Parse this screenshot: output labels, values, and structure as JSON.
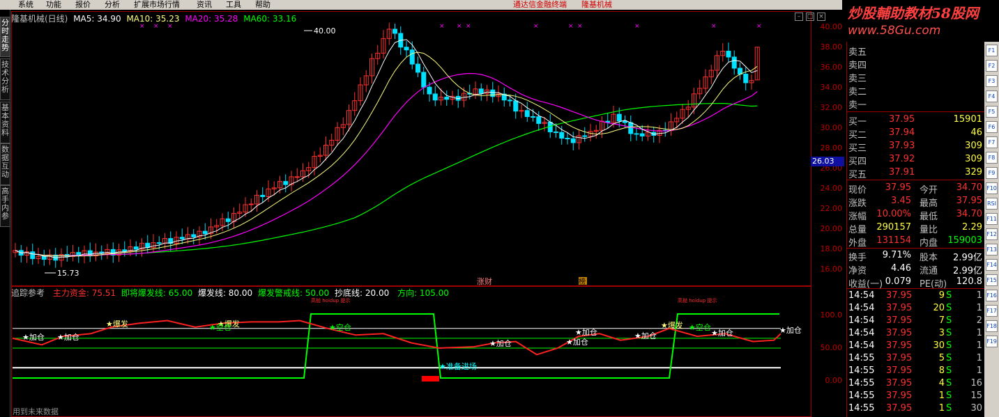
{
  "menu": [
    "系统",
    "功能",
    "报价",
    "分析",
    "扩展市场行情",
    "资讯",
    "工具",
    "帮助"
  ],
  "menu_center": [
    "通达信金融终端",
    "隆基机械"
  ],
  "watermark": {
    "line1": "炒股輔助教材58股网",
    "line2": "www.58Gu.com"
  },
  "left_tabs": [
    "分时走势",
    "技术分析",
    "基本资料",
    "数据互动",
    "高手内参"
  ],
  "main_header": {
    "name": "隆基机械(日线)",
    "ma5": "MA5: 34.90",
    "ma10": "MA10: 35.23",
    "ma20": "MA20: 35.28",
    "ma60": "MA60: 33.16"
  },
  "sub_header": {
    "name": "追踪参考",
    "l1": "主力资金: 75.51",
    "l2": "即将爆发线: 65.00",
    "l3": "爆发线: 80.00",
    "l4": "爆发警戒线: 50.00",
    "l5": "抄底线: 20.00",
    "l6": "方向: 105.00"
  },
  "price_axis": [
    "40.00",
    "38.00",
    "36.00",
    "34.00",
    "32.00",
    "30.00",
    "28.00",
    "26.00",
    "24.00",
    "22.00",
    "20.00",
    "18.00",
    "16.00"
  ],
  "cur_price": "26.03",
  "sub_axis": [
    "100.0",
    "50.00",
    "0.00"
  ],
  "chart_labels": {
    "high": "40.00",
    "low": "15.73",
    "tag1": "涨财",
    "tag2": "榜",
    "note1": "高抛 holdup 提示",
    "note2": "高抛 holdup 提示"
  },
  "signal_labels": [
    "加仓",
    "加仓",
    "爆发",
    "爆发",
    "空仓",
    "空仓",
    "准备进场",
    "加仓",
    "加仓",
    "加仓",
    "加仓",
    "爆发",
    "空仓",
    "加仓",
    "加仓"
  ],
  "quote": {
    "sell": [
      {
        "label": "卖五"
      },
      {
        "label": "卖四"
      },
      {
        "label": "卖三"
      },
      {
        "label": "卖二"
      },
      {
        "label": "卖一"
      }
    ],
    "buy": [
      {
        "label": "买一",
        "price": "37.95",
        "vol": "15901"
      },
      {
        "label": "买二",
        "price": "37.94",
        "vol": "46"
      },
      {
        "label": "买三",
        "price": "37.93",
        "vol": "309"
      },
      {
        "label": "买四",
        "price": "37.92",
        "vol": "309"
      },
      {
        "label": "买五",
        "price": "37.91",
        "vol": "329"
      }
    ],
    "stats": [
      {
        "l1": "现价",
        "v1": "37.95",
        "l2": "今开",
        "v2": "34.70"
      },
      {
        "l1": "涨跌",
        "v1": "3.45",
        "l2": "最高",
        "v2": "37.95"
      },
      {
        "l1": "涨幅",
        "v1": "10.00%",
        "l2": "最低",
        "v2": "34.70"
      },
      {
        "l1": "总量",
        "v1": "290157",
        "l2": "量比",
        "v2": "2.29"
      },
      {
        "l1": "外盘",
        "v1": "131154",
        "l2": "内盘",
        "v2": "159003"
      }
    ],
    "stats2": [
      {
        "l1": "换手",
        "v1": "9.71%",
        "l2": "股本",
        "v2": "2.99亿"
      },
      {
        "l1": "净资",
        "v1": "4.46",
        "l2": "流通",
        "v2": "2.99亿"
      },
      {
        "l1": "收益(一)",
        "v1": "0.079",
        "l2": "PE(动)",
        "v2": "120.8"
      }
    ],
    "ticks": [
      {
        "t": "14:54",
        "p": "37.95",
        "v": "9",
        "s": "S",
        "n": "1"
      },
      {
        "t": "14:54",
        "p": "37.95",
        "v": "20",
        "s": "S",
        "n": "1"
      },
      {
        "t": "14:54",
        "p": "37.95",
        "v": "7",
        "s": "S",
        "n": "2"
      },
      {
        "t": "14:54",
        "p": "37.95",
        "v": "3",
        "s": "S",
        "n": "1"
      },
      {
        "t": "14:54",
        "p": "37.95",
        "v": "30",
        "s": "S",
        "n": "1"
      },
      {
        "t": "14:55",
        "p": "37.95",
        "v": "5",
        "s": "S",
        "n": "1"
      },
      {
        "t": "14:55",
        "p": "37.95",
        "v": "8",
        "s": "S",
        "n": "1"
      },
      {
        "t": "14:55",
        "p": "37.95",
        "v": "4",
        "s": "S",
        "n": "16"
      },
      {
        "t": "14:55",
        "p": "37.95",
        "v": "1",
        "s": "S",
        "n": "15"
      },
      {
        "t": "14:55",
        "p": "37.95",
        "v": "1",
        "s": "S",
        "n": "30"
      }
    ]
  },
  "toolbar_icons": [
    "F1",
    "F2",
    "F3",
    "F4",
    "F5",
    "F6",
    "F7",
    "F8",
    "F9",
    "F10",
    "RSI",
    "F11",
    "F12",
    "F13",
    "F14",
    "F15",
    "F16",
    "F17",
    "F18",
    "F19"
  ],
  "footer": "用到未来数据",
  "colors": {
    "up": "#ff3030",
    "down": "#00e0ff",
    "ma5": "#ffffff",
    "ma10": "#ffff80",
    "ma20": "#ff00ff",
    "ma60": "#00ff00",
    "zl": "#ff2020",
    "dir": "#00ff00"
  }
}
